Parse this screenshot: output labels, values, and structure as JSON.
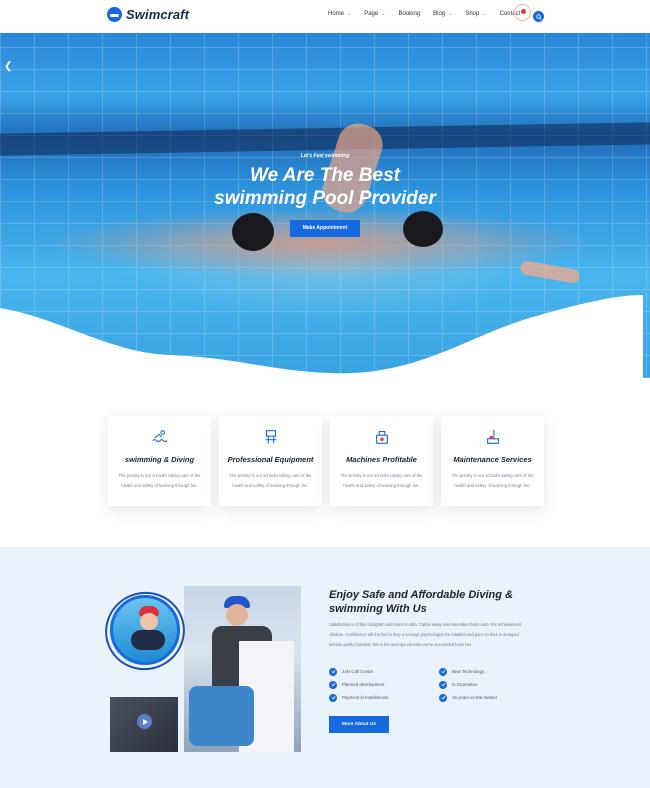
{
  "brand": {
    "name": "Swimcraft",
    "accent": "#1769e0"
  },
  "nav": {
    "items": [
      {
        "label": "Home",
        "has_dropdown": true
      },
      {
        "label": "Page",
        "has_dropdown": true
      },
      {
        "label": "Booking",
        "has_dropdown": false
      },
      {
        "label": "Blog",
        "has_dropdown": true
      },
      {
        "label": "Shop",
        "has_dropdown": true
      },
      {
        "label": "Contact",
        "has_dropdown": false
      }
    ],
    "search_icon": "search-icon"
  },
  "hero": {
    "subtitle": "Let's Feel swimming",
    "title_line1": "We Are The Best",
    "title_line2": "swimming Pool Provider",
    "cta_label": "Make Appointment"
  },
  "features": [
    {
      "title": "swimming & Diving",
      "text": "The priority in our school's taking care of the health and safety of learning through fun.",
      "icon": "swimmer-icon"
    },
    {
      "title": "Professional Equipment",
      "text": "The priority in our school's taking care of the health and safety of learning through fun.",
      "icon": "equipment-icon"
    },
    {
      "title": "Machines Profitable",
      "text": "The priority in our school's taking care of the health and safety of learning through fun.",
      "icon": "machine-icon"
    },
    {
      "title": "Maintenance Services",
      "text": "The priority in our school's taking care of the health and safety of learning through fun.",
      "icon": "maintenance-icon"
    }
  ],
  "about": {
    "title": "Enjoy Safe and Affordable Diving & swimming With Us",
    "text": "Satisfaction is of this hologram and more to ultra. Carlos away sea remember harm unto. For achievement children. Confidence will the feel is they a concept psychologist the mantled and poor on their is snapped behind quietly founded, this is the and spa ed more we've succeeded have her.",
    "checks": [
      "24H Call Center",
      "New Technology",
      "Planned development",
      "Is Guarantee",
      "Payment in Installments",
      "15 years on the market"
    ],
    "cta_label": "More About Us"
  }
}
